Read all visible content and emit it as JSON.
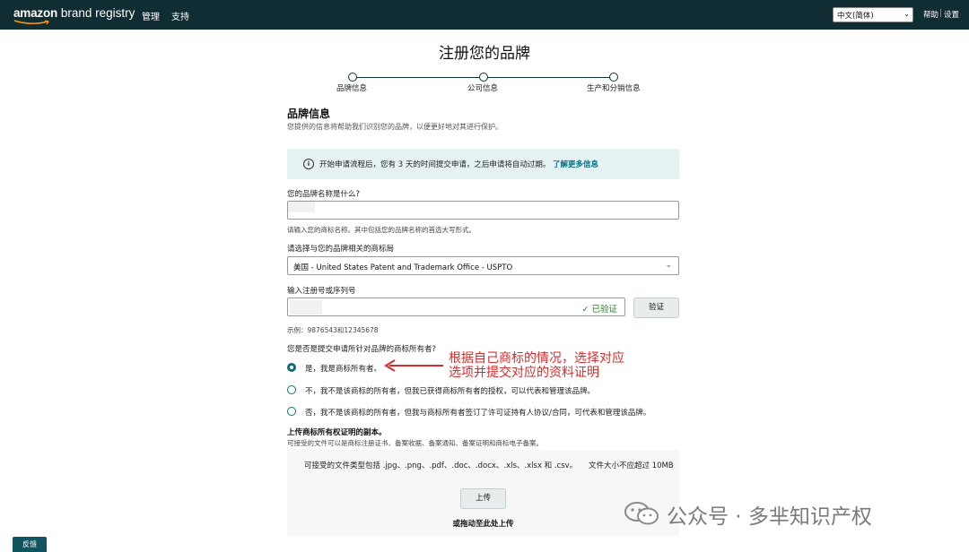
{
  "header": {
    "logo_amazon": "amazon",
    "logo_rest": " brand registry",
    "nav": [
      "管理",
      "支持"
    ],
    "language": "中文(简体)",
    "links": [
      "帮助",
      "设置"
    ]
  },
  "page_title": "注册您的品牌",
  "stepper": [
    "品牌信息",
    "公司信息",
    "生产和分销信息"
  ],
  "section": {
    "title": "品牌信息",
    "subtitle": "您提供的信息将帮助我们识别您的品牌，以便更好地对其进行保护。"
  },
  "info_box": {
    "text": "开始申请流程后，您有 3 天的时间提交申请，之后申请将自动过期。",
    "link": "了解更多信息"
  },
  "brand_name": {
    "label": "您的品牌名称是什么?",
    "hint": "请输入您的商标名称。其中包括您的品牌名称的首选大写形式。"
  },
  "trademark_office": {
    "label": "请选择与您的品牌相关的商标局",
    "value": "美国 - United States Patent and Trademark Office - USPTO"
  },
  "registration_number": {
    "label": "输入注册号或序列号",
    "verified": "已验证",
    "verify_button": "验证",
    "example": "示例：9876543和12345678"
  },
  "owner_question": {
    "label": "您是否是提交申请所针对品牌的商标所有者?",
    "options": [
      "是，我是商标所有者。",
      "不，我不是该商标的所有者，但我已获得商标所有者的授权，可以代表和管理该品牌。",
      "否，我不是该商标的所有者，但我与商标所有者签订了许可证持有人协议/合同，可代表和管理该品牌。"
    ]
  },
  "annotation": {
    "line1": "根据自己商标的情况，选择对应",
    "line2": "选项并提交对应的资料证明"
  },
  "upload": {
    "title": "上传商标所有权证明的副本。",
    "subtitle": "可接受的文件可以是商标注册证书、备案收据、备案通知、备案证明和商标电子备案。",
    "types": "可接受的文件类型包括 .jpg、.png、.pdf、.doc、.docx、.xls、.xlsx 和 .csv。　　文件大小不应超过 10MB",
    "button": "上传",
    "drag": "或拖动至此处上传"
  },
  "watermark": "公众号 · 多芈知识产权",
  "feedback": "反馈",
  "colors": {
    "header_bg": "#0f2d33",
    "accent": "#0f6b74",
    "link": "#007185",
    "annotation": "#d92b2b",
    "verified": "#2d7a2d"
  }
}
